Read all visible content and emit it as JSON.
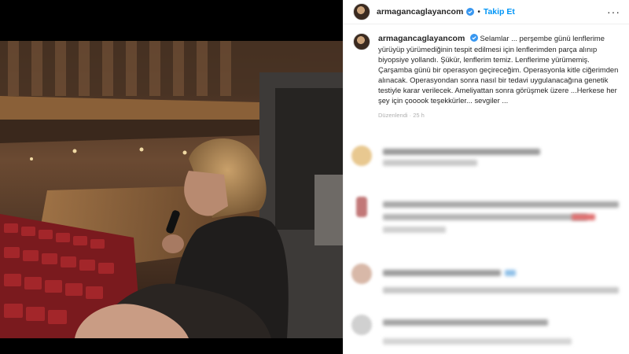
{
  "post": {
    "username": "armagancaglayancom",
    "follow_label": "Takip Et",
    "more_label": "···",
    "separator": "•",
    "caption": "Selamlar ... perşembe günü lenflerime yürüyüp yürümediğinin tespit edilmesi için lenflerimden parça alınıp biyopsiye yollandı. Şükür, lenflerim temiz. Lenflerime yürümemiş. Çarşamba günü bir operasyon geçireceğim. Operasyonla kitle ciğerimden alınacak. Operasyondan sonra nasıl bir tedavi uygulanacağına genetik testiyle karar verilecek. Ameliyattan sonra görüşmek üzere ...Herkese her şey için çooook teşekkürler... sevgiler ...",
    "meta": "Düzenlendi · 25 h"
  },
  "colors": {
    "follow_blue": "#0095f6",
    "verified_blue": "#3897f0",
    "text": "#262626"
  },
  "comments_note": "blurred comments"
}
